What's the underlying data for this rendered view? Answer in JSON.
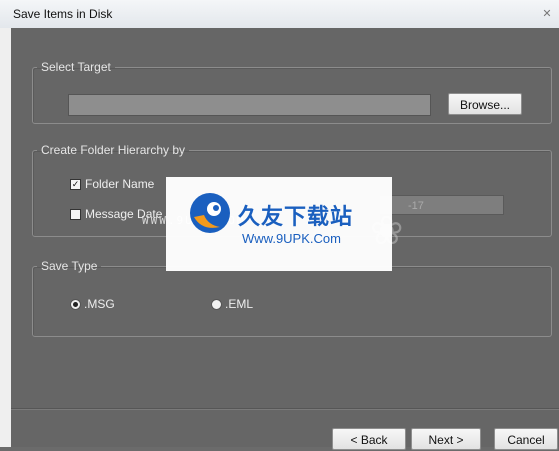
{
  "window": {
    "title": "Save Items in Disk",
    "close_glyph": "✕"
  },
  "select_target": {
    "legend": "Select Target",
    "path_value": "",
    "browse_label": "Browse..."
  },
  "folder_hierarchy": {
    "legend": "Create Folder Hierarchy by",
    "folder_name": {
      "label": "Folder Name",
      "checked": true
    },
    "message_date": {
      "label": "Message Date",
      "checked": false
    },
    "date_value": "-17"
  },
  "save_type": {
    "legend": "Save Type",
    "options": [
      {
        "label": ".MSG",
        "selected": true
      },
      {
        "label": ".EML",
        "selected": false
      }
    ]
  },
  "footer": {
    "back_label": "< Back",
    "next_label": "Next >",
    "cancel_label": "Cancel"
  },
  "watermark": {
    "brand_cn": "久友下载站",
    "url": "Www.9UPK.Com",
    "left_text": "WWW.9UPK.COM"
  },
  "icons": {
    "checkmark": "check-icon",
    "radio_dot": "radio-dot-icon",
    "logo": "swirl-logo-icon"
  },
  "colors": {
    "dialog_bg": "#666666",
    "titlebar_bg": "#e9ecf0",
    "logo_blue": "#1a5fbf",
    "logo_orange": "#f39a1c"
  }
}
